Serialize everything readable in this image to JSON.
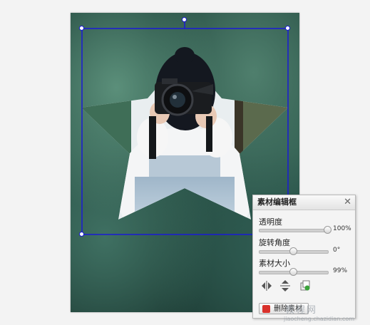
{
  "panel": {
    "title": "素材编辑框",
    "close_glyph": "✕",
    "opacity": {
      "label": "透明度",
      "value_text": "100%",
      "fraction": 1.0
    },
    "rotation": {
      "label": "旋转角度",
      "value_text": "0°",
      "fraction": 0.5
    },
    "size": {
      "label": "素材大小",
      "value_text": "99%",
      "fraction": 0.5
    },
    "tools": [
      {
        "icon": "flip-horizontal-icon"
      },
      {
        "icon": "flip-vertical-icon"
      },
      {
        "icon": "duplicate-icon"
      }
    ],
    "delete_button_label": "删除素材"
  },
  "watermark": {
    "main": "教程网",
    "sub": "jiaocheng.chazidian.com"
  },
  "colors": {
    "selection": "#1a1ad6",
    "star_background": "#f2f2f2",
    "delete_icon": "#d9312b"
  }
}
